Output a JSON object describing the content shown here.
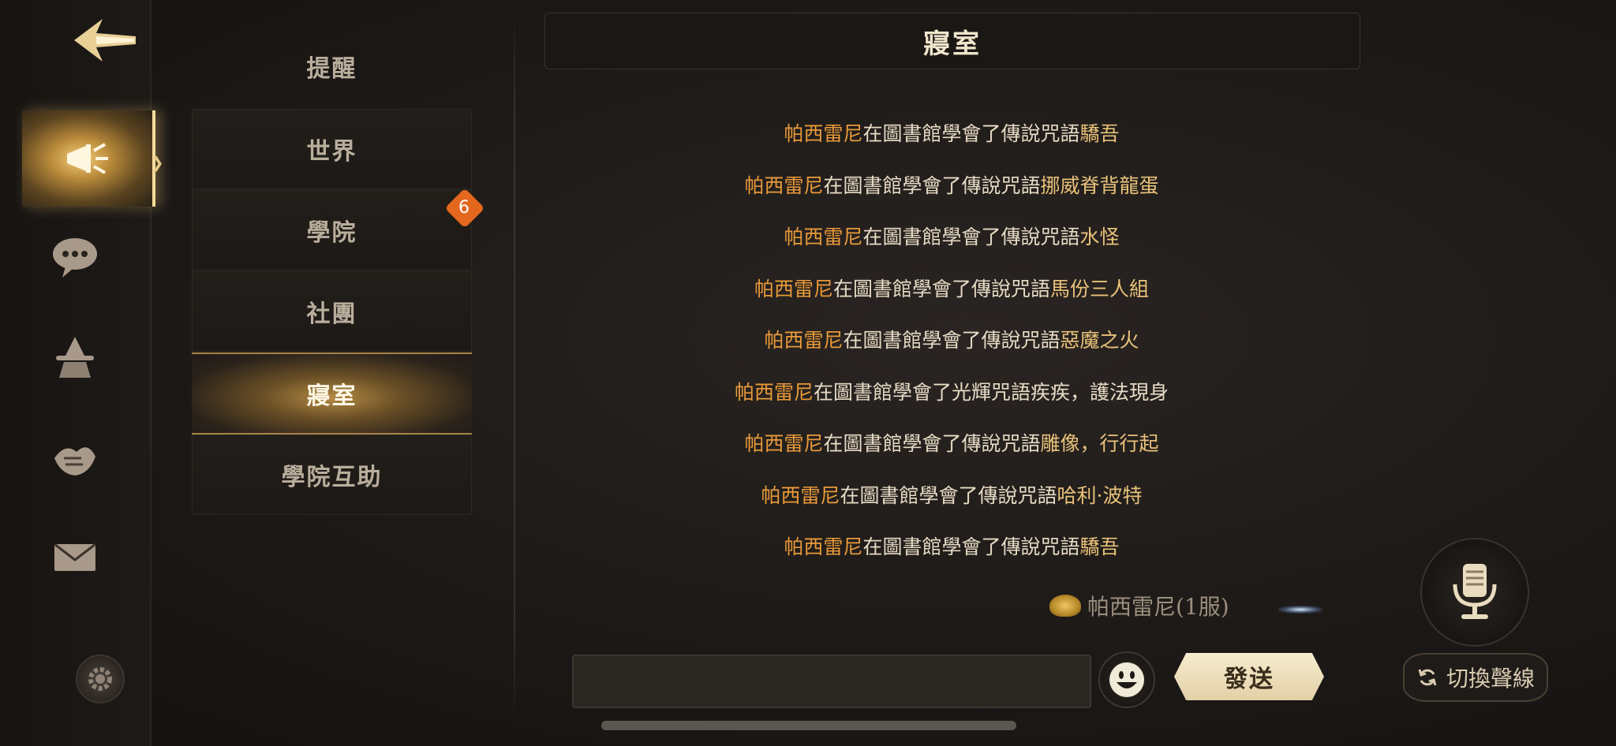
{
  "rail": {
    "items": [
      {
        "name": "announcement-icon"
      },
      {
        "name": "chat-bubble-icon"
      },
      {
        "name": "wizard-icon"
      },
      {
        "name": "handshake-icon"
      },
      {
        "name": "mail-icon"
      }
    ],
    "active_index": 0
  },
  "channels": {
    "items": [
      {
        "label": "提醒"
      },
      {
        "label": "世界"
      },
      {
        "label": "學院",
        "badge": "6"
      },
      {
        "label": "社團"
      },
      {
        "label": "寢室"
      },
      {
        "label": "學院互助"
      }
    ],
    "active_label": "寢室"
  },
  "header": {
    "title": "寢室"
  },
  "messages": [
    {
      "who": "帕西雷尼",
      "act": "在圖書館學會了傳說咒語",
      "spell": "驕吾"
    },
    {
      "who": "帕西雷尼",
      "act": "在圖書館學會了傳說咒語",
      "spell": "挪威脊背龍蛋"
    },
    {
      "who": "帕西雷尼",
      "act": "在圖書館學會了傳說咒語",
      "spell": "水怪"
    },
    {
      "who": "帕西雷尼",
      "act": "在圖書館學會了傳說咒語",
      "spell": "馬份三人組"
    },
    {
      "who": "帕西雷尼",
      "act": "在圖書館學會了傳說咒語",
      "spell": "惡魔之火"
    },
    {
      "who": "帕西雷尼",
      "act": "在圖書館學會了光輝咒語疾疾，護法現身",
      "spell": ""
    },
    {
      "who": "帕西雷尼",
      "act": "在圖書館學會了傳說咒語",
      "spell": "雕像，行行起"
    },
    {
      "who": "帕西雷尼",
      "act": "在圖書館學會了傳說咒語",
      "spell": "哈利·波特"
    },
    {
      "who": "帕西雷尼",
      "act": "在圖書館學會了傳說咒語",
      "spell": "驕吾"
    }
  ],
  "sender": {
    "name": "帕西雷尼(1服)"
  },
  "input": {
    "value": "",
    "placeholder": ""
  },
  "send_label": "發送",
  "switch_label": "切換聲線",
  "colors": {
    "player_name": "#e99a3a",
    "spell_name": "#e9c27a",
    "body_text": "#e7dbc5",
    "badge": "#e4671e",
    "accent_gold": "#f5cf7a"
  }
}
